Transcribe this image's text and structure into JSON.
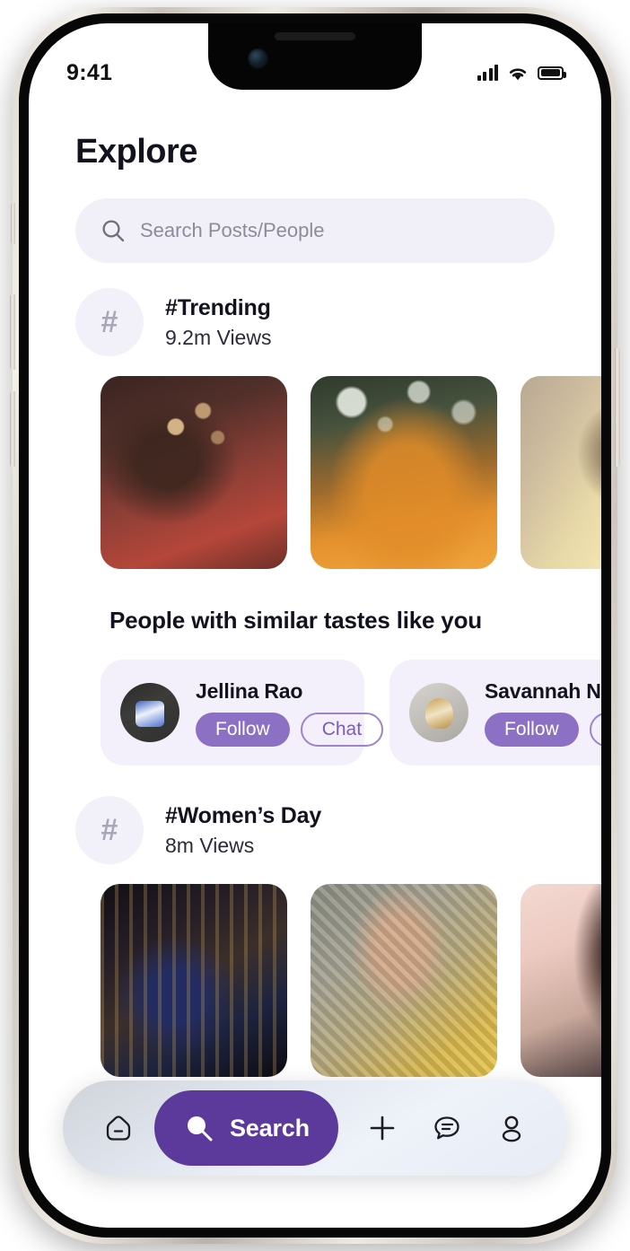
{
  "status_bar": {
    "time": "9:41",
    "signal_icon": "cellular-bars-icon",
    "wifi_icon": "wifi-icon",
    "battery_icon": "battery-icon"
  },
  "header": {
    "title": "Explore"
  },
  "search": {
    "icon": "search-icon",
    "placeholder": "Search Posts/People",
    "value": ""
  },
  "sections": [
    {
      "tag": "#Trending",
      "views": "9.2m Views",
      "hash_glyph": "#",
      "photos": [
        {
          "name": "photo-woman-red-outfit",
          "style": "ph-red"
        },
        {
          "name": "photo-woman-orange-saree",
          "style": "ph-orange"
        },
        {
          "name": "photo-woman-yellow-gown",
          "style": "ph-yellow"
        }
      ]
    },
    {
      "tag": "#Women’s Day",
      "views": "8m Views",
      "hash_glyph": "#",
      "photos": [
        {
          "name": "photo-woman-blue-gown",
          "style": "ph-blue"
        },
        {
          "name": "photo-woman-yellow-portrait",
          "style": "ph-ylwport"
        },
        {
          "name": "photo-woman-pink-backdrop",
          "style": "ph-pink"
        }
      ]
    }
  ],
  "people": {
    "title": "People with similar tastes like you",
    "follow_label": "Follow",
    "chat_label": "Chat",
    "cards": [
      {
        "name": "Jellina Rao",
        "avatar_style": "av-jellina"
      },
      {
        "name": "Savannah Nguyen",
        "avatar_style": "av-savannah"
      }
    ]
  },
  "bottom_nav": {
    "home_icon": "home-icon",
    "search_icon": "search-icon",
    "search_label": "Search",
    "add_icon": "plus-icon",
    "chat_icon": "chat-bubble-icon",
    "profile_icon": "profile-icon"
  },
  "colors": {
    "accent_purple": "#5b3a9b",
    "follow_purple": "#8b70c4",
    "chat_outline": "#9c84cf",
    "card_lavender": "#f3f0fb",
    "search_field": "#f1eff8",
    "text_dark": "#13131f"
  }
}
